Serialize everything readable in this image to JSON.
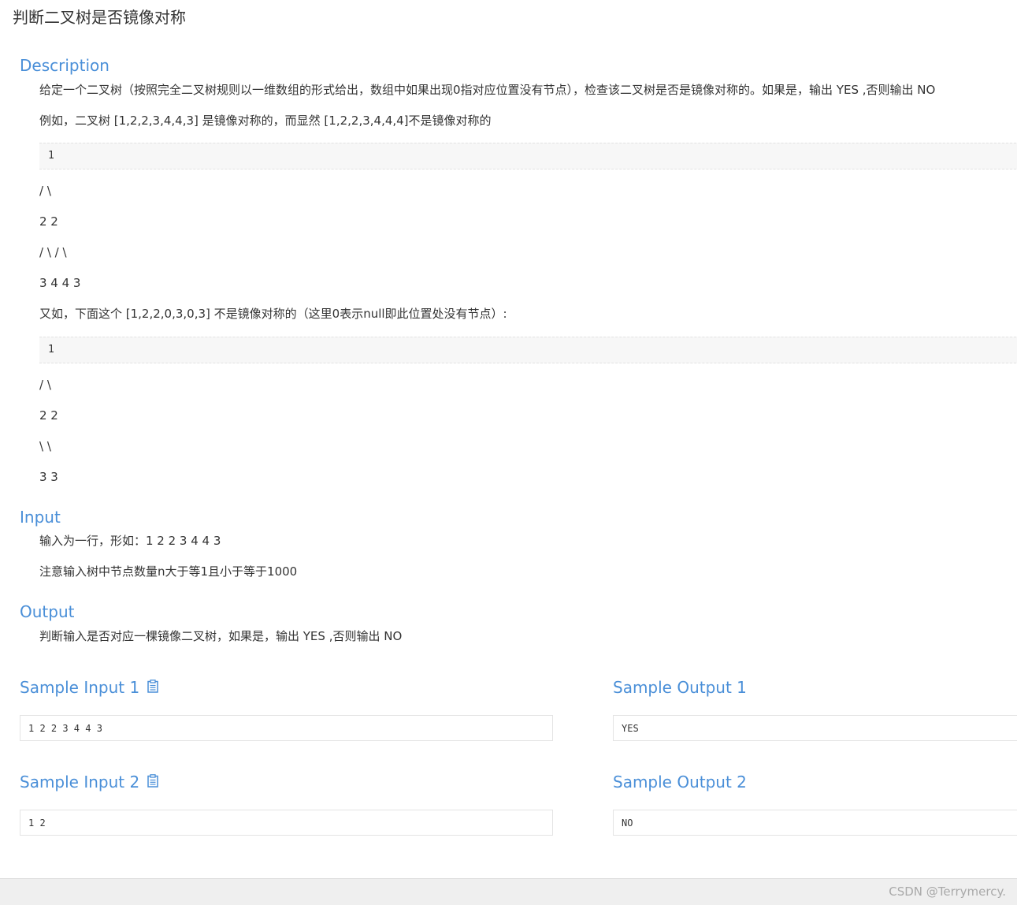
{
  "title": "判断二叉树是否镜像对称",
  "description": {
    "heading": "Description",
    "p1": "给定一个二叉树（按照完全二叉树规则以一维数组的形式给出，数组中如果出现0指对应位置没有节点），检查该二叉树是否是镜像对称的。如果是，输出 YES ,否则输出 NO",
    "p2": "例如，二叉树 [1,2,2,3,4,4,3] 是镜像对称的，而显然 [1,2,2,3,4,4,4]不是镜像对称的",
    "example1": {
      "code": "1",
      "lines": [
        "/ \\",
        "2 2",
        "/ \\ / \\",
        "3 4 4 3"
      ]
    },
    "p3": "又如，下面这个 [1,2,2,0,3,0,3] 不是镜像对称的（这里0表示null即此位置处没有节点）:",
    "example2": {
      "code": "1",
      "lines": [
        "/ \\",
        "2 2",
        "\\ \\",
        "3 3"
      ]
    }
  },
  "input": {
    "heading": "Input",
    "p1": "输入为一行，形如：1 2 2 3 4 4 3",
    "p2": "注意输入树中节点数量n大于等1且小于等于1000"
  },
  "output": {
    "heading": "Output",
    "p1": "判断输入是否对应一棵镜像二叉树，如果是，输出 YES ,否则输出 NO"
  },
  "samples": [
    {
      "input_label": "Sample Input 1",
      "input_value": "1 2 2 3 4 4 3",
      "output_label": "Sample Output 1",
      "output_value": "YES"
    },
    {
      "input_label": "Sample Input 2",
      "input_value": "1 2",
      "output_label": "Sample Output 2",
      "output_value": "NO"
    }
  ],
  "icons": {
    "copy": "clipboard-icon"
  },
  "colors": {
    "heading": "#4a8fd8",
    "text": "#333333",
    "code_bg": "#f7f7f7"
  },
  "footer": {
    "watermark": "CSDN @Terrymercy."
  }
}
